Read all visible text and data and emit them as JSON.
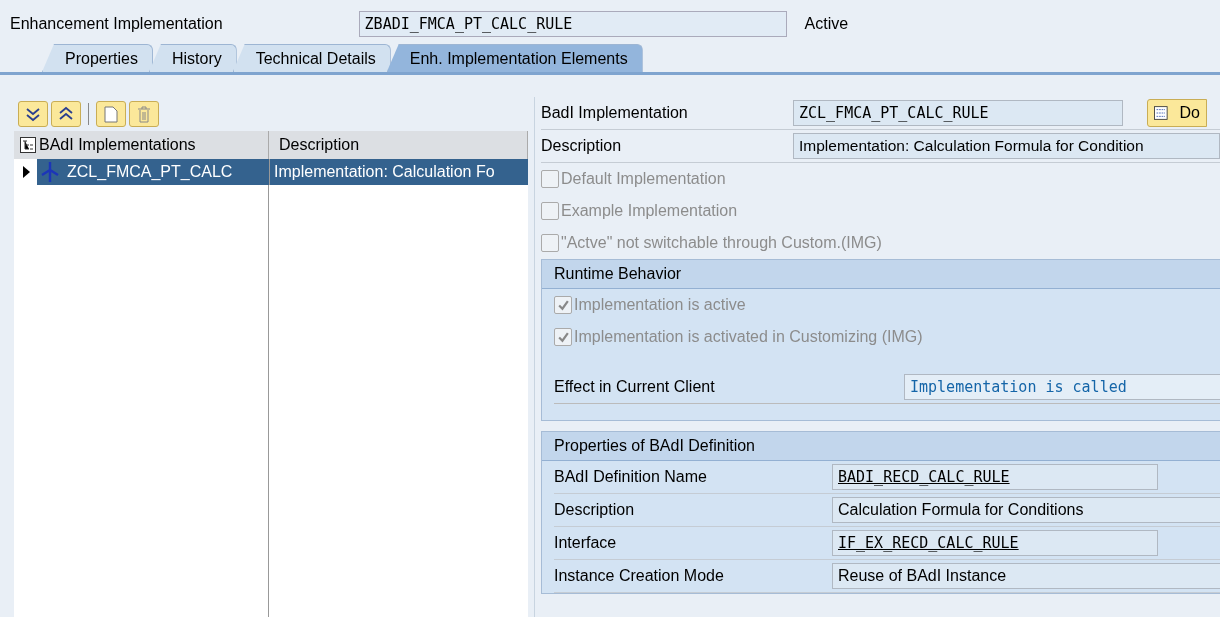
{
  "header": {
    "label": "Enhancement Implementation",
    "value": "ZBADI_FMCA_PT_CALC_RULE",
    "status": "Active"
  },
  "tabs": [
    {
      "label": "Properties",
      "selected": false
    },
    {
      "label": "History",
      "selected": false
    },
    {
      "label": "Technical Details",
      "selected": false
    },
    {
      "label": "Enh. Implementation Elements",
      "selected": true
    }
  ],
  "tree": {
    "columns": [
      "BAdI Implementations",
      "Description"
    ],
    "rows": [
      {
        "name": "ZCL_FMCA_PT_CALC",
        "description": "Implementation: Calculation Fo",
        "selected": true,
        "expanded": false
      }
    ]
  },
  "detail": {
    "implementation": {
      "label": "BadI Implementation",
      "value": "ZCL_FMCA_PT_CALC_RULE",
      "button": "Do"
    },
    "description": {
      "label": "Description",
      "value": "Implementation: Calculation Formula for Condition"
    },
    "options": [
      {
        "label": "Default Implementation",
        "checked": false,
        "disabled": true
      },
      {
        "label": "Example Implementation",
        "checked": false,
        "disabled": true
      },
      {
        "label": "\"Actve\" not switchable through Custom.(IMG)",
        "checked": false,
        "disabled": true
      }
    ],
    "runtime": {
      "title": "Runtime Behavior",
      "options": [
        {
          "label": "Implementation is active",
          "checked": true,
          "disabled": true
        },
        {
          "label": "Implementation is activated in Customizing (IMG)",
          "checked": true,
          "disabled": true
        }
      ],
      "effect_label": "Effect in Current Client",
      "effect_value": "Implementation is called"
    },
    "definition": {
      "title": "Properties of BAdI Definition",
      "rows": [
        {
          "label": "BAdI Definition Name",
          "value": "BADI_RECD_CALC_RULE",
          "kind": "link"
        },
        {
          "label": "Description",
          "value": "Calculation Formula for Conditions",
          "kind": "text"
        },
        {
          "label": "Interface",
          "value": "IF_EX_RECD_CALC_RULE",
          "kind": "link"
        },
        {
          "label": "Instance Creation Mode",
          "value": "Reuse of BAdI Instance",
          "kind": "text"
        }
      ]
    }
  }
}
